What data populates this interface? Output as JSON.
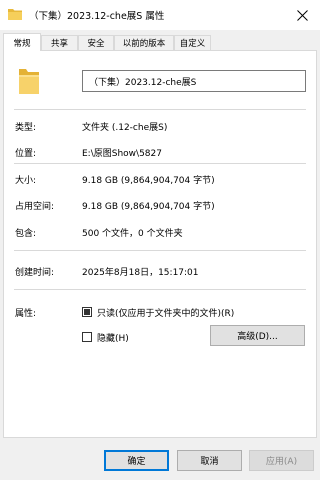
{
  "window": {
    "title": "（下集）2023.12-che展S 属性",
    "close_icon": "close-icon"
  },
  "tabs": [
    {
      "label": "常规",
      "active": true
    },
    {
      "label": "共享",
      "active": false
    },
    {
      "label": "安全",
      "active": false
    },
    {
      "label": "以前的版本",
      "active": false
    },
    {
      "label": "自定义",
      "active": false
    }
  ],
  "general": {
    "name_value": "（下集）2023.12-che展S",
    "type_label": "类型:",
    "type_value": "文件夹 (.12-che展S)",
    "location_label": "位置:",
    "location_value": "E:\\原图Show\\5827",
    "size_label": "大小:",
    "size_value": "9.18 GB (9,864,904,704 字节)",
    "size_on_disk_label": "占用空间:",
    "size_on_disk_value": "9.18 GB (9,864,904,704 字节)",
    "contains_label": "包含:",
    "contains_value": "500 个文件，0 个文件夹",
    "created_label": "创建时间:",
    "created_value": "2025年8月18日，15:17:01",
    "attributes_label": "属性:",
    "readonly_label": "只读(仅应用于文件夹中的文件)(R)",
    "readonly_checked": true,
    "hidden_label": "隐藏(H)",
    "hidden_checked": false,
    "advanced_button": "高级(D)..."
  },
  "buttons": {
    "ok": "确定",
    "cancel": "取消",
    "apply": "应用(A)"
  },
  "colors": {
    "folder": "#f2c94c",
    "accent": "#0078d7"
  }
}
